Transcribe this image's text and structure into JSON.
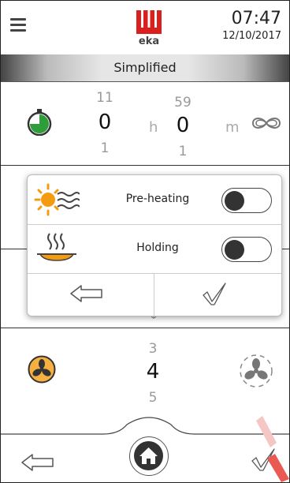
{
  "header": {
    "logo_text": "eka",
    "time": "07:47",
    "date": "12/10/2017"
  },
  "mode": {
    "label": "Simplified"
  },
  "timer": {
    "hours": {
      "prev": "11",
      "current": "0",
      "next": "1",
      "unit": "h"
    },
    "minutes": {
      "prev": "59",
      "current": "0",
      "next": "1",
      "unit": "m"
    }
  },
  "popup": {
    "rows": [
      {
        "label": "Pre-heating",
        "icon": "sun-heat-icon",
        "enabled": false
      },
      {
        "label": "Holding",
        "icon": "plate-steam-icon",
        "enabled": false
      }
    ]
  },
  "fan": {
    "prev": "3",
    "current": "4",
    "next": "5"
  },
  "colors": {
    "accent": "#e8b43a",
    "timer_green": "#2e9e3a",
    "brand_red": "#d9201f",
    "dark": "#333333"
  }
}
